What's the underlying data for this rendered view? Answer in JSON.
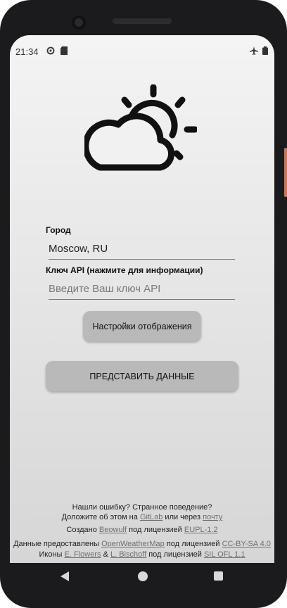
{
  "status_bar": {
    "time": "21:34",
    "icons": [
      "sync-icon",
      "sd-card-icon",
      "airplane-icon",
      "battery-icon"
    ]
  },
  "city": {
    "label": "Город",
    "value": "Moscow, RU"
  },
  "api_key": {
    "label": "Ключ API (нажмите для информации)",
    "placeholder": "Введите Ваш ключ API"
  },
  "buttons": {
    "display_settings": "Настройки отображения",
    "submit": "ПРЕДСТАВИТЬ ДАННЫЕ"
  },
  "footer": {
    "line1": "Нашли ошибку? Странное поведение?",
    "line2_prefix": "Доложите об этом на",
    "gitlab_link": "GitLab",
    "line2_mid": "или через",
    "mail_link": "почту",
    "created_prefix": "Создано",
    "author_link": "Beowulf",
    "license_prefix": "под лицензией",
    "license_link": "EUPL-1.2",
    "data_prefix": "Данные предоставлены",
    "owm_link": "OpenWeatherMap",
    "data_license_prefix": "под лицензией",
    "data_license_link": "CC-BY-SA 4.0",
    "icons_prefix": "Иконы",
    "icons_author1": "E. Flowers",
    "icons_amp": "&",
    "icons_author2": "L. Bischoff",
    "icons_license_prefix": "под лицензией",
    "icons_license_link": "SIL OFL 1.1"
  },
  "colors": {
    "background_top": "#f4f4f4",
    "background_bottom": "#d6d6d6",
    "button": "#b9b9b9",
    "link": "#6f6f6f"
  }
}
